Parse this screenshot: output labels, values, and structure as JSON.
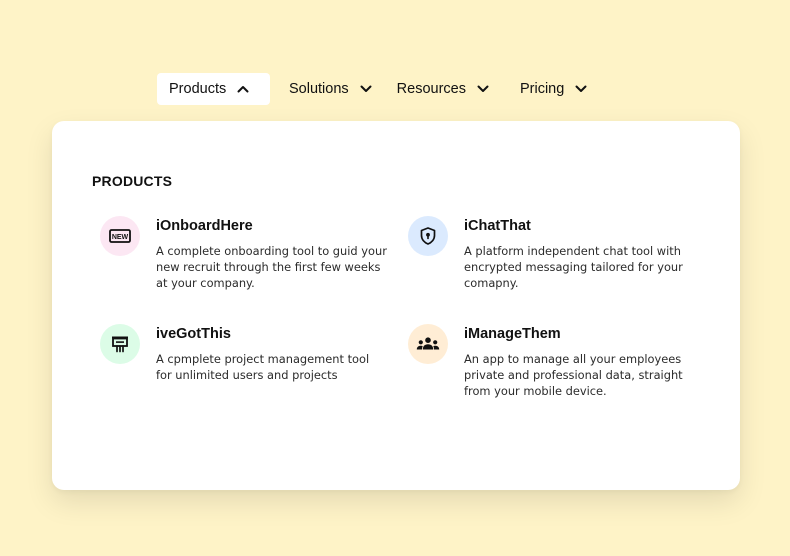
{
  "nav": {
    "items": [
      {
        "label": "Products",
        "chevron": "chevron-up-icon",
        "active": true
      },
      {
        "label": "Solutions",
        "chevron": "chevron-down-icon",
        "active": false
      },
      {
        "label": "Resources",
        "chevron": "chevron-down-icon",
        "active": false
      },
      {
        "label": "Pricing",
        "chevron": "chevron-down-icon",
        "active": false
      }
    ]
  },
  "panel": {
    "heading": "PRODUCTS",
    "products": [
      {
        "name": "iOnboardHere",
        "description": "A complete onboarding tool to guid your new recruit through the first few weeks at your company.",
        "icon": "new-badge-icon",
        "icon_bg": "#fce7f3"
      },
      {
        "name": "iChatThat",
        "description": "A platform independent chat tool with encrypted messaging tailored for your comapny.",
        "icon": "shield-lock-icon",
        "icon_bg": "#dbeafe"
      },
      {
        "name": "iveGotThis",
        "description": "A cpmplete project management tool for unlimited users and projects",
        "icon": "presentation-icon",
        "icon_bg": "#dcfce7"
      },
      {
        "name": "iManageThem",
        "description": "An app to manage all your employees private and professional data, straight from your mobile device.",
        "icon": "people-group-icon",
        "icon_bg": "#ffedd5"
      }
    ]
  },
  "colors": {
    "page_bg": "#fef3c7",
    "panel_bg": "#ffffff",
    "text": "#111111"
  }
}
